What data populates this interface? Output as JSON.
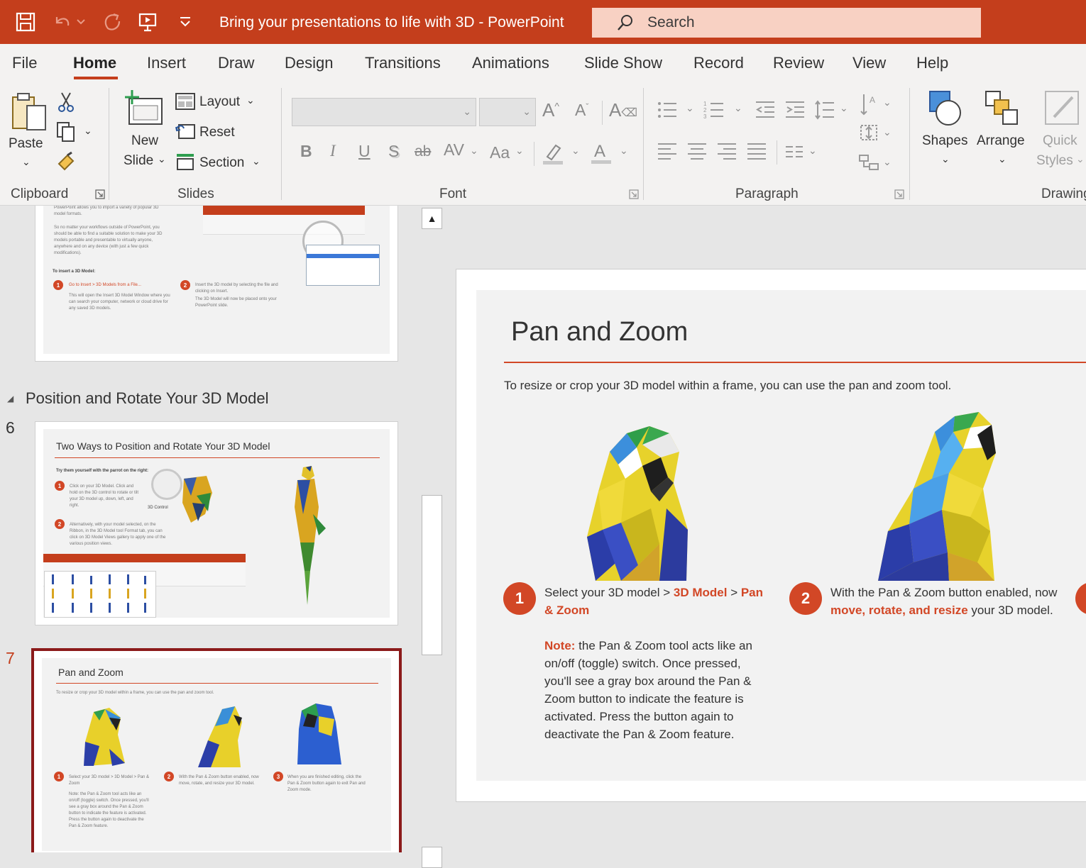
{
  "titlebar": {
    "doc_title": "Bring your presentations to life with 3D  -  PowerPoint",
    "search_placeholder": "Search",
    "icons": [
      "save-icon",
      "undo-icon",
      "undo-dropdown-icon",
      "redo-icon",
      "present-icon",
      "customize-qat-icon",
      "search-icon"
    ]
  },
  "menu": {
    "tabs": [
      "File",
      "Home",
      "Insert",
      "Draw",
      "Design",
      "Transitions",
      "Animations",
      "Slide Show",
      "Record",
      "Review",
      "View",
      "Help"
    ],
    "active": "Home"
  },
  "ribbon": {
    "clipboard": {
      "paste": "Paste",
      "group": "Clipboard"
    },
    "slides": {
      "new_slide_1": "New",
      "new_slide_2": "Slide",
      "layout": "Layout",
      "reset": "Reset",
      "section": "Section",
      "group": "Slides"
    },
    "font": {
      "group": "Font",
      "bold": "B",
      "italic": "I",
      "underline": "U",
      "shadow": "S",
      "strike": "ab",
      "spacing": "AV",
      "case": "Aa",
      "grow": "A^",
      "shrink": "A",
      "color": "A"
    },
    "paragraph": {
      "group": "Paragraph"
    },
    "drawing": {
      "shapes": "Shapes",
      "arrange": "Arrange",
      "quick_1": "Quick",
      "quick_2": "Styles",
      "group": "Drawing"
    }
  },
  "thumbnails": {
    "section_header": "Position and Rotate Your 3D Model",
    "slide5": {
      "lines": [
        "PowerPoint allows you to import a variety of popular 3D",
        "model formats.",
        "So no matter your workflows outside of PowerPoint, you",
        "should be able to find a suitable solution to make your 3D",
        "models portable and presentable to virtually anyone,",
        "anywhere and on any device (with just a few quick",
        "modifications)."
      ],
      "heading": "To insert a 3D Model:",
      "step1": "Go to Insert > 3D Models from a File...",
      "step1_sub": "This will open the Insert 3D Model Window where you can search your computer, network or cloud drive for any saved 3D models.",
      "step2": "Insert the 3D model by selecting the file and clicking on Insert.",
      "step2_sub": "The 3D Model will now be placed onto your PowerPoint slide."
    },
    "slide6": {
      "number": "6",
      "title": "Two Ways to Position and Rotate Your 3D Model",
      "intro": "Try them yourself with the parrot on the right:",
      "step1": "Click on your 3D Model. Click and hold on the 3D control to rotate or tilt your 3D model up, down, left, and right.",
      "step2": "Alternatively, with your model selected, on the Ribbon, in the 3D Model tool Format tab, you can click on 3D Model Views gallery to apply one of the various position views.",
      "control_label": "3D Control"
    },
    "slide7": {
      "number": "7",
      "title": "Pan and Zoom",
      "sub": "To resize or crop your 3D model within a frame, you can use the pan and zoom tool.",
      "step1": "Select your 3D model > 3D Model > Pan & Zoom",
      "step2": "With the Pan & Zoom button enabled, now move, rotate, and resize your 3D model.",
      "step3": "When you are finished editing, click the Pan & Zoom button again to exit Pan and Zoom mode.",
      "note": "Note: the Pan & Zoom tool acts like an on/off (toggle) switch. Once pressed, you'll see a gray box around the Pan & Zoom button to indicate the feature is activated. Press the button again to deactivate the Pan & Zoom feature."
    }
  },
  "slide": {
    "title": "Pan and Zoom",
    "subtitle": "To resize or crop your 3D model within a frame, you can use the pan and zoom tool.",
    "step1_num": "1",
    "step1_a": "Select your 3D model  >  ",
    "step1_b": "3D Model",
    "step1_c": "  >  ",
    "step1_d": "Pan",
    "step1_e": "& Zoom",
    "step2_num": "2",
    "step2_a": "With the Pan & Zoom button enabled, now",
    "step2_b": "move, rotate, and resize",
    "step2_c": " your 3D model.",
    "note_label": "Note:",
    "note_lines": [
      " the Pan & Zoom tool acts like an",
      "on/off (toggle) switch. Once pressed,",
      "you'll see a gray box around the Pan &",
      "Zoom button to indicate the feature is",
      "activated. Press the button again to",
      "deactivate the Pan & Zoom feature."
    ]
  },
  "colors": {
    "accent": "#c43e1c",
    "slide_red": "#d24726",
    "selected_thumb": "#8b1a1a"
  }
}
